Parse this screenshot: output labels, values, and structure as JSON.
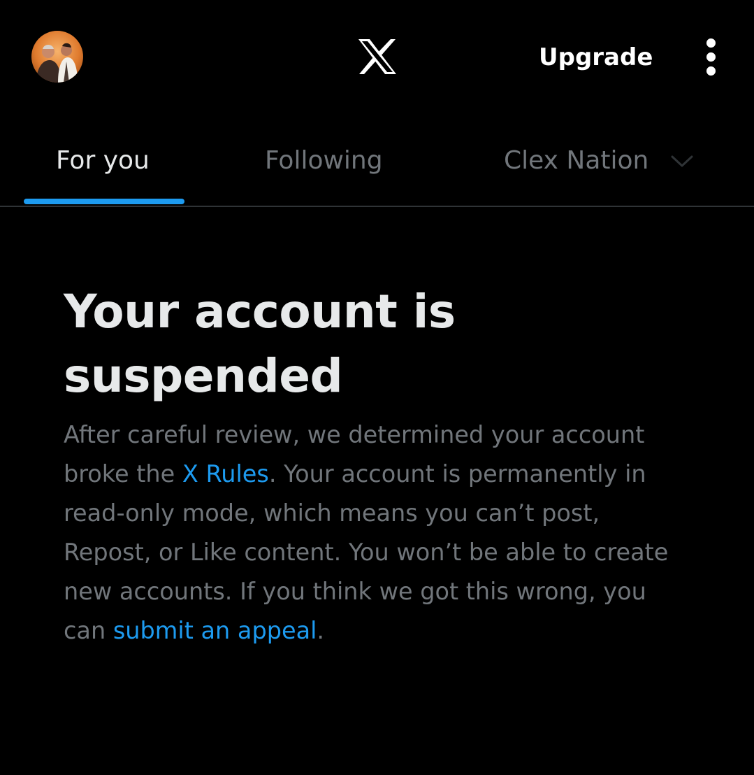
{
  "header": {
    "avatar_alt": "Profile",
    "logo": "x-logo-icon",
    "upgrade_label": "Upgrade",
    "more_icon": "more-vertical-icon"
  },
  "tabs": [
    {
      "label": "For you",
      "selected": true
    },
    {
      "label": "Following",
      "selected": false
    },
    {
      "label": "Clex Nation",
      "selected": false,
      "icon": "chevron-down-icon"
    }
  ],
  "notice": {
    "title": "Your account is suspended",
    "body_part1": "After careful review, we determined your account broke the ",
    "rules_link": "X Rules",
    "body_part2": ". Your account is permanently in read-only mode, which means you can’t post, Repost, or Like content. You won’t be able to create new accounts. If you think we got this wrong, you can ",
    "appeal_link": "submit an appeal",
    "body_end": "."
  },
  "colors": {
    "background": "#000000",
    "primary_text": "#e7e9ea",
    "secondary_text": "#71767b",
    "accent": "#1d9bf0",
    "divider": "#2f3336"
  }
}
